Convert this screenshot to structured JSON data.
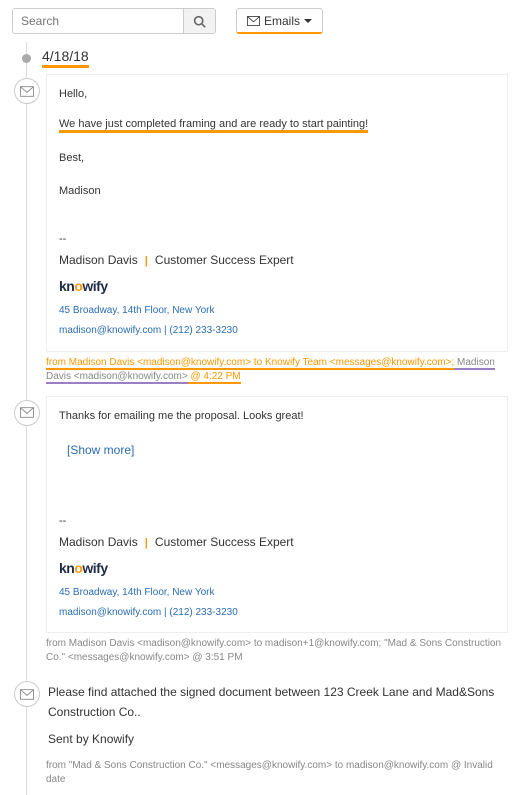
{
  "search": {
    "placeholder": "Search"
  },
  "emailsButton": {
    "label": "Emails"
  },
  "date": "4/18/18",
  "emails": [
    {
      "body": {
        "greet": "Hello,",
        "line": "We have just completed framing and are ready to start painting!",
        "best": "Best,",
        "sign": "Madison"
      },
      "sigName": "Madison Davis",
      "sigTitle": "Customer Success Expert",
      "logo": {
        "p1": "kn",
        "p2": "o",
        "p3": "wify"
      },
      "addr": "45 Broadway, 14th Floor, New York",
      "contact": "madison@knowify.com | (212) 233-3230",
      "meta": {
        "a": "from Madison Davis <madison@knowify.com>",
        "b": " to Knowify Team <messages@knowify.com>;",
        "c": " Madison Davis <madison@knowify.com>",
        "d": " @ 4:22 PM"
      }
    },
    {
      "preview": "Thanks for emailing me the proposal.  Looks great!",
      "showMore": "[Show more]",
      "sigName": "Madison Davis",
      "sigTitle": "Customer Success Expert",
      "logo": {
        "p1": "kn",
        "p2": "o",
        "p3": "wify"
      },
      "addr": "45 Broadway, 14th Floor, New York",
      "contact": "madison@knowify.com | (212) 233-3230",
      "meta": "from Madison Davis <madison@knowify.com> to madison+1@knowify.com; \"Mad & Sons Construction Co.\" <messages@knowify.com> @ 3:51 PM"
    },
    {
      "line1": "Please find attached the signed document between 123 Creek Lane and Mad&Sons Construction Co..",
      "line2": "Sent by Knowify",
      "meta": "from \"Mad & Sons Construction Co.\" <messages@knowify.com> to madison@knowify.com @ Invalid date"
    }
  ]
}
